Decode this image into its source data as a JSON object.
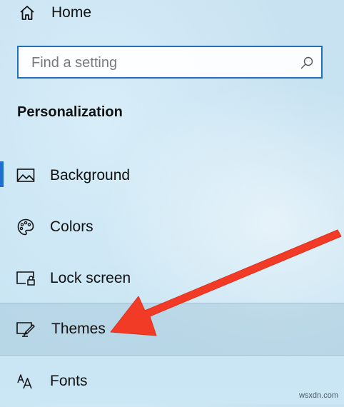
{
  "nav": {
    "home_label": "Home"
  },
  "search": {
    "placeholder": "Find a setting"
  },
  "section": {
    "title": "Personalization"
  },
  "items": [
    {
      "label": "Background",
      "icon": "picture-icon",
      "selected": true
    },
    {
      "label": "Colors",
      "icon": "palette-icon",
      "selected": false
    },
    {
      "label": "Lock screen",
      "icon": "lock-screen-icon",
      "selected": false
    },
    {
      "label": "Themes",
      "icon": "themes-icon",
      "selected": false,
      "hovered": true
    },
    {
      "label": "Fonts",
      "icon": "fonts-icon",
      "selected": false
    }
  ],
  "annotation": {
    "arrow_color": "#f23b26",
    "points_to": "Themes"
  },
  "watermark": "wsxdn.com",
  "colors": {
    "accent": "#1f6fd1",
    "search_border": "#1d72b8"
  }
}
